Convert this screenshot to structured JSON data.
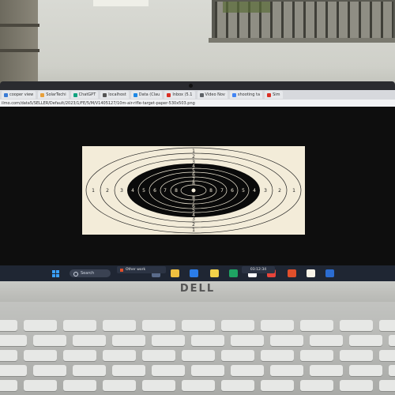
{
  "browser": {
    "tabs": [
      {
        "label": "cooper view",
        "color": "#3a7bd5"
      },
      {
        "label": "SolarTechi",
        "color": "#e8a03a"
      },
      {
        "label": "ChatGPT",
        "color": "#10a37f"
      },
      {
        "label": "localhost",
        "color": "#555555"
      },
      {
        "label": "Data (Clau",
        "color": "#1e88e5"
      },
      {
        "label": "Inbox (5.1",
        "color": "#d93025"
      },
      {
        "label": "Video Nov",
        "color": "#5f6368"
      },
      {
        "label": "shooting ta",
        "color": "#4285f4"
      },
      {
        "label": "Sim",
        "color": "#d93025"
      }
    ],
    "url": "ilmo.com/data5/SELLER/Default/2023/1/FE/5/M/V1405127/10m-air-rifle-target-paper-530x503.png"
  },
  "target": {
    "ring_numbers": [
      "1",
      "2",
      "3",
      "4",
      "5",
      "6",
      "7",
      "8"
    ],
    "paper_color": "#f3ecd9",
    "black_color": "#0a0a0a"
  },
  "taskbar": {
    "search_label": "Search",
    "media_label": "Other work",
    "tray_time": "03:12:34"
  },
  "logo": {
    "text": "DELL"
  },
  "keyboard": {
    "rows": 5
  }
}
